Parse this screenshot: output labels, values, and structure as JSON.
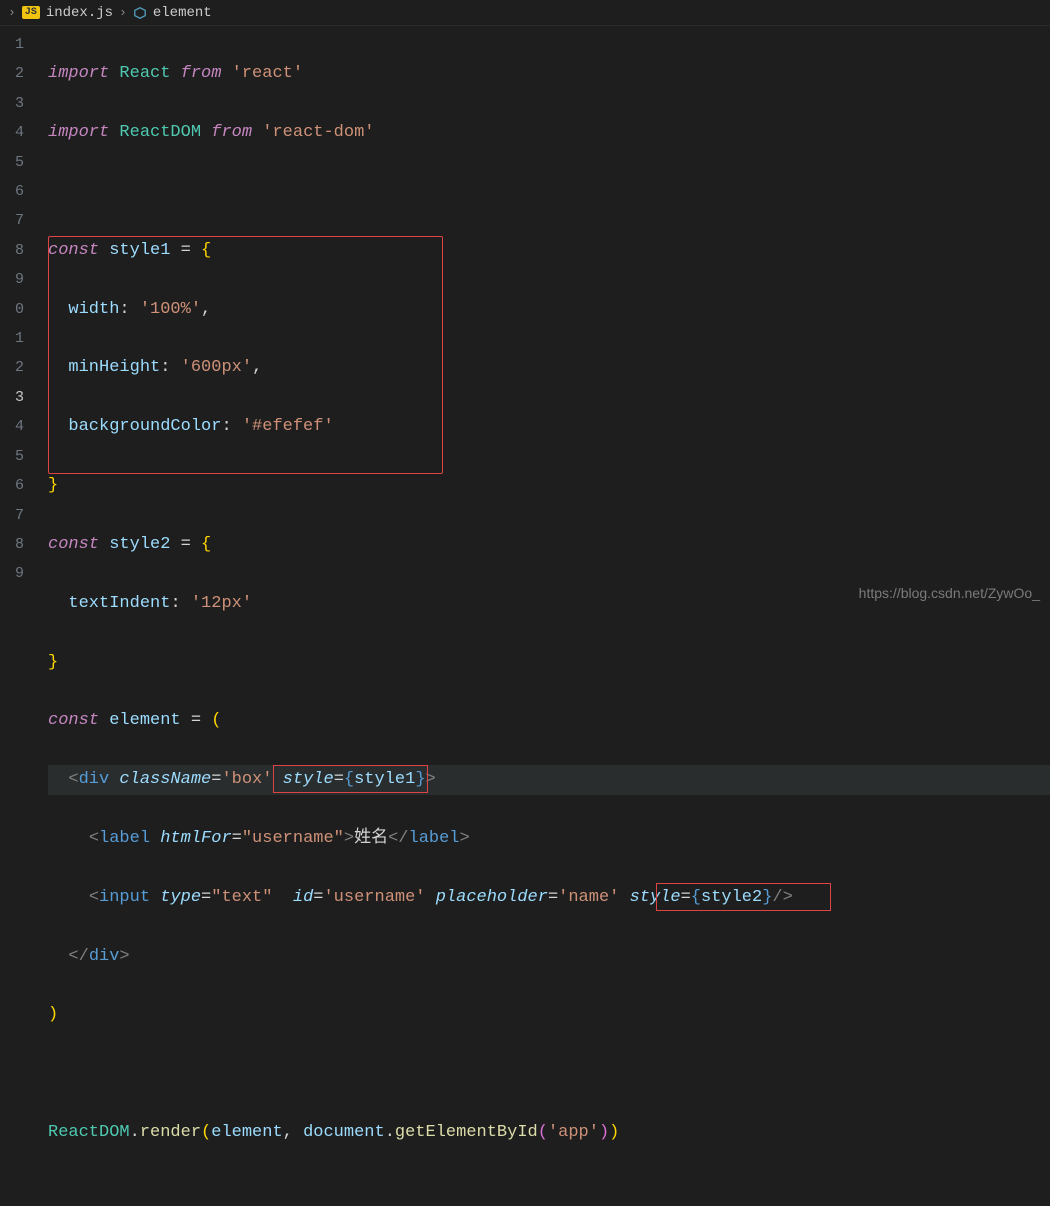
{
  "breadcrumb": {
    "chevron": "›",
    "file_icon": "JS",
    "file": "index.js",
    "sep": "›",
    "symbol_glyph": "◇",
    "symbol": "element"
  },
  "gutter": [
    "1",
    "2",
    "3",
    "4",
    "5",
    "6",
    "7",
    "8",
    "9",
    "0",
    "1",
    "2",
    "3",
    "4",
    "5",
    "6",
    "7",
    "8",
    "9"
  ],
  "tok": {
    "import": "import",
    "from": "from",
    "React": "React",
    "ReactDOM": "ReactDOM",
    "s_react": "'react'",
    "s_reactdom": "'react-dom'",
    "const": "const",
    "style1": "style1",
    "style2": "style2",
    "element": "element",
    "eq": "=",
    "lb": "{",
    "rb": "}",
    "lp": "(",
    "rp": ")",
    "la": "<",
    "ra": ">",
    "slash": "/",
    "colon": ":",
    "comma": ",",
    "width": "width",
    "s_100": "'100%'",
    "minHeight": "minHeight",
    "s_600px": "'600px'",
    "backgroundColor": "backgroundColor",
    "s_efefef": "'#efefef'",
    "textIndent": "textIndent",
    "s_12px": "'12px'",
    "div": "div",
    "label": "label",
    "input": "input",
    "className": "className",
    "s_box": "'box'",
    "style": "style",
    "htmlFor": "htmlFor",
    "s_username": "\"username\"",
    "xingming": "姓名",
    "type": "type",
    "s_text": "\"text\"",
    "id": "id",
    "s_username2": "'username'",
    "placeholder": "placeholder",
    "s_name": "'name'",
    "render": "render",
    "document": "document",
    "getElementById": "getElementById",
    "s_app": "'app'",
    "dot": "."
  },
  "watermark": "https://blog.csdn.net/ZywOo_"
}
